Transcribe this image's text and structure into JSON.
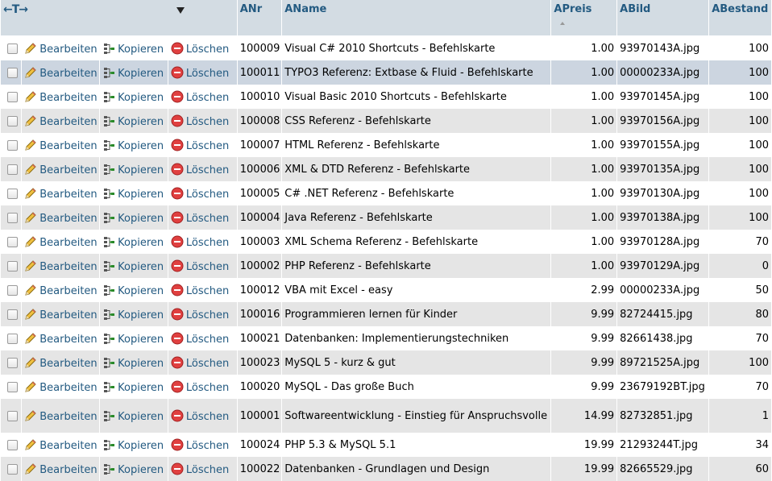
{
  "header": {
    "arrows": "←T→",
    "columns": [
      "ANr",
      "AName",
      "APreis",
      "ABild",
      "ABestand"
    ]
  },
  "actions": {
    "edit": "Bearbeiten",
    "copy": "Kopieren",
    "delete": "Löschen"
  },
  "colors": {
    "header_bg": "#d3dce3",
    "link": "#235a81",
    "row_odd": "#e5e5e5",
    "row_highlight": "#ccd5e0"
  },
  "rows": [
    {
      "anr": "100009",
      "aname": "Visual C# 2010 Shortcuts - Befehlskarte",
      "apreis": "1.00",
      "abild": "93970143A.jpg",
      "abestand": "100"
    },
    {
      "anr": "100011",
      "aname": "TYPO3 Referenz: Extbase & Fluid - Befehlskarte",
      "apreis": "1.00",
      "abild": "00000233A.jpg",
      "abestand": "100"
    },
    {
      "anr": "100010",
      "aname": "Visual Basic 2010 Shortcuts - Befehlskarte",
      "apreis": "1.00",
      "abild": "93970145A.jpg",
      "abestand": "100"
    },
    {
      "anr": "100008",
      "aname": "CSS Referenz - Befehlskarte",
      "apreis": "1.00",
      "abild": "93970156A.jpg",
      "abestand": "100"
    },
    {
      "anr": "100007",
      "aname": "HTML Referenz - Befehlskarte",
      "apreis": "1.00",
      "abild": "93970155A.jpg",
      "abestand": "100"
    },
    {
      "anr": "100006",
      "aname": "XML & DTD Referenz - Befehlskarte",
      "apreis": "1.00",
      "abild": "93970135A.jpg",
      "abestand": "100"
    },
    {
      "anr": "100005",
      "aname": "C# .NET Referenz - Befehlskarte",
      "apreis": "1.00",
      "abild": "93970130A.jpg",
      "abestand": "100"
    },
    {
      "anr": "100004",
      "aname": "Java Referenz - Befehlskarte",
      "apreis": "1.00",
      "abild": "93970138A.jpg",
      "abestand": "100"
    },
    {
      "anr": "100003",
      "aname": "XML Schema Referenz - Befehlskarte",
      "apreis": "1.00",
      "abild": "93970128A.jpg",
      "abestand": "70"
    },
    {
      "anr": "100002",
      "aname": "PHP Referenz - Befehlskarte",
      "apreis": "1.00",
      "abild": "93970129A.jpg",
      "abestand": "0"
    },
    {
      "anr": "100012",
      "aname": "VBA mit Excel - easy",
      "apreis": "2.99",
      "abild": "00000233A.jpg",
      "abestand": "50"
    },
    {
      "anr": "100016",
      "aname": "Programmieren lernen für Kinder",
      "apreis": "9.99",
      "abild": "82724415.jpg",
      "abestand": "80"
    },
    {
      "anr": "100021",
      "aname": "Datenbanken: Implementierungstechniken",
      "apreis": "9.99",
      "abild": "82661438.jpg",
      "abestand": "70"
    },
    {
      "anr": "100023",
      "aname": "MySQL 5 - kurz & gut",
      "apreis": "9.99",
      "abild": "89721525A.jpg",
      "abestand": "100"
    },
    {
      "anr": "100020",
      "aname": "MySQL - Das große Buch",
      "apreis": "9.99",
      "abild": "23679192BT.jpg",
      "abestand": "70"
    },
    {
      "anr": "100001",
      "aname": "Softwareentwicklung - Einstieg für Anspruchsvolle",
      "apreis": "14.99",
      "abild": "82732851.jpg",
      "abestand": "1"
    },
    {
      "anr": "100024",
      "aname": "PHP 5.3 & MySQL 5.1",
      "apreis": "19.99",
      "abild": "21293244T.jpg",
      "abestand": "34"
    },
    {
      "anr": "100022",
      "aname": "Datenbanken - Grundlagen und Design",
      "apreis": "19.99",
      "abild": "82665529.jpg",
      "abestand": "60"
    }
  ]
}
